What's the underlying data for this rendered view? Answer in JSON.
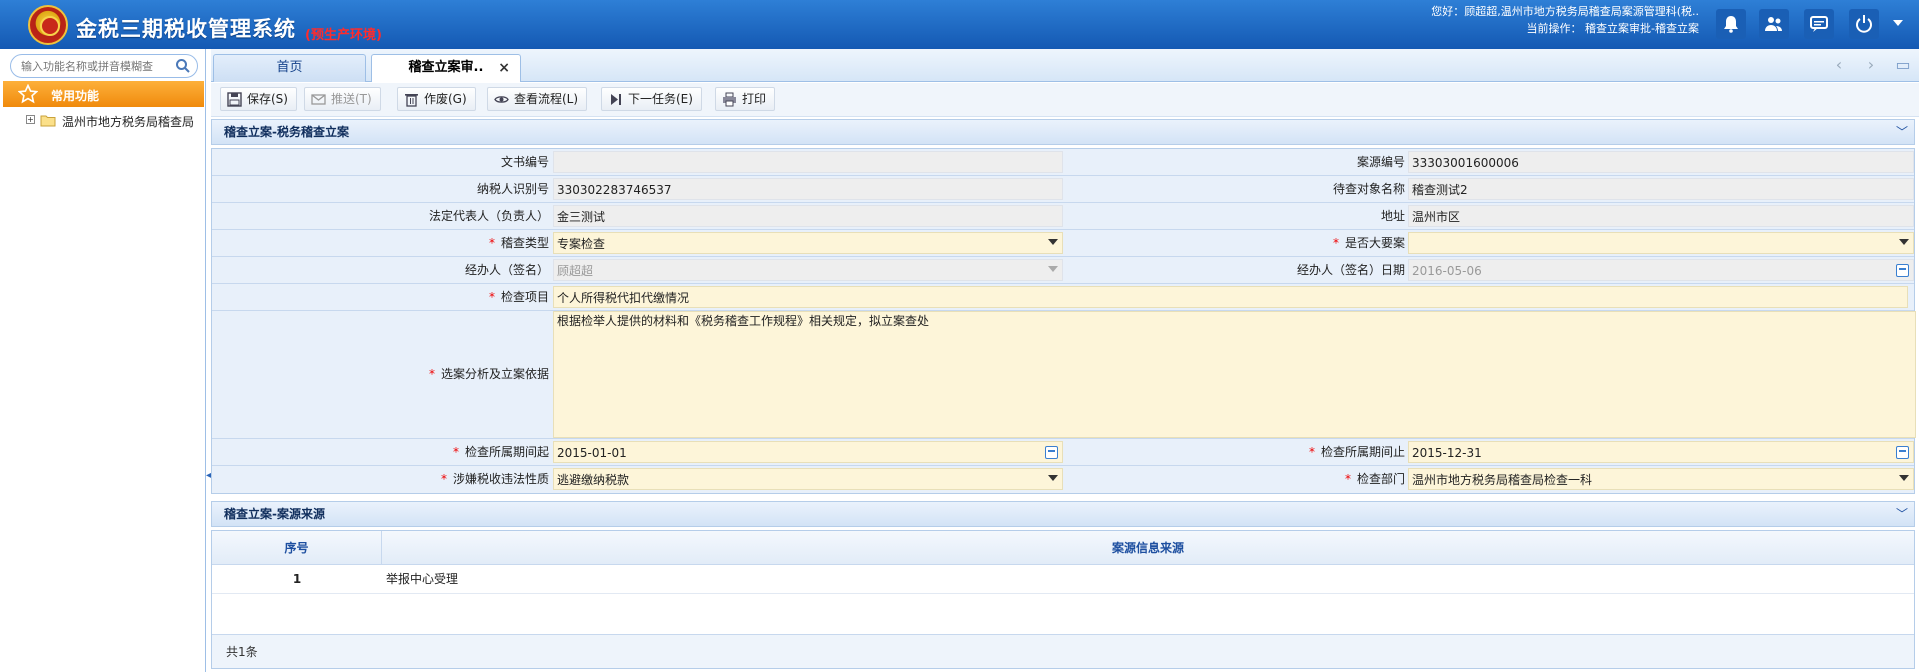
{
  "header": {
    "title": "金税三期税收管理系统",
    "env_tag": "(预生产环境)",
    "greeting": "您好：顾超超,温州市地方税务局稽查局案源管理科(税..",
    "current_op": "当前操作： 稽查立案审批-稽查立案",
    "icons": [
      "bell-icon",
      "users-icon",
      "chat-icon",
      "power-icon",
      "menu-chevron-icon"
    ]
  },
  "sidebar": {
    "search_placeholder": "输入功能名称或拼音模糊查",
    "favorites_label": "常用功能",
    "tree_item": "温州市地方税务局稽查局"
  },
  "tabs": [
    {
      "label": "首页"
    },
    {
      "label": "稽查立案审..",
      "close": "×"
    }
  ],
  "toolbar": {
    "save": "保存(S)",
    "push": "推送(T)",
    "void": "作废(G)",
    "flow": "查看流程(L)",
    "next": "下一任务(E)",
    "print": "打印"
  },
  "form": {
    "title": "稽查立案-税务稽查立案",
    "doc_no_label": "文书编号",
    "doc_no": "",
    "case_no_label": "案源编号",
    "case_no": "33303001600006",
    "taxpayer_id_label": "纳税人识别号",
    "taxpayer_id": "330302283746537",
    "target_name_label": "待查对象名称",
    "target_name": "稽查测试2",
    "legal_rep_label": "法定代表人（负责人）",
    "legal_rep": "金三测试",
    "address_label": "地址",
    "address": "温州市区",
    "audit_type_label": "稽查类型",
    "audit_type": "专案检查",
    "major_case_label": "是否大要案",
    "major_case": "",
    "handler_label": "经办人（签名）",
    "handler": "顾超超",
    "handler_date_label": "经办人（签名）日期",
    "handler_date": "2016-05-06",
    "check_item_label": "检查项目",
    "check_item": "个人所得税代扣代缴情况",
    "basis_label": "选案分析及立案依据",
    "basis": "根据检举人提供的材料和《税务稽查工作规程》相关规定，拟立案查处",
    "period_start_label": "检查所属期间起",
    "period_start": "2015-01-01",
    "period_end_label": "检查所属期间止",
    "period_end": "2015-12-31",
    "violation_label": "涉嫌税收违法性质",
    "violation": "逃避缴纳税款",
    "dept_label": "检查部门",
    "dept": "温州市地方税务局稽查局检查一科",
    "required_mark": "*"
  },
  "source": {
    "title": "稽查立案-案源来源",
    "col_no": "序号",
    "col_src": "案源信息来源",
    "rows": [
      {
        "no": "1",
        "src": "举报中心受理"
      }
    ],
    "footer": "共1条"
  },
  "colors": {
    "header_blue": "#1b63be",
    "accent_orange": "#f29a1e",
    "env_red": "#ff2b2b",
    "editable_bg": "#fdf5d9"
  }
}
